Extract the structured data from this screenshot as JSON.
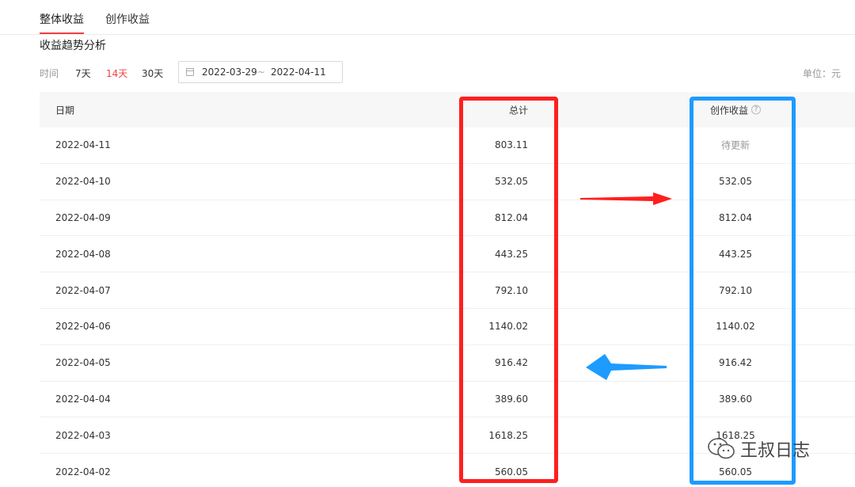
{
  "tabs": [
    {
      "label": "整体收益",
      "active": true
    },
    {
      "label": "创作收益",
      "active": false
    }
  ],
  "section_title": "收益趋势分析",
  "filters": {
    "time_label": "时间",
    "ranges": [
      {
        "label": "7天",
        "active": false
      },
      {
        "label": "14天",
        "active": true
      },
      {
        "label": "30天",
        "active": false
      }
    ],
    "start_date": "2022-03-29",
    "separator": "~",
    "end_date": "2022-04-11",
    "unit": "单位：元"
  },
  "table": {
    "headers": {
      "date": "日期",
      "total": "总计",
      "creation": "创作收益"
    },
    "rows": [
      {
        "date": "2022-04-11",
        "total": "803.11",
        "creation": "待更新"
      },
      {
        "date": "2022-04-10",
        "total": "532.05",
        "creation": "532.05"
      },
      {
        "date": "2022-04-09",
        "total": "812.04",
        "creation": "812.04"
      },
      {
        "date": "2022-04-08",
        "total": "443.25",
        "creation": "443.25"
      },
      {
        "date": "2022-04-07",
        "total": "792.10",
        "creation": "792.10"
      },
      {
        "date": "2022-04-06",
        "total": "1140.02",
        "creation": "1140.02"
      },
      {
        "date": "2022-04-05",
        "total": "916.42",
        "creation": "916.42"
      },
      {
        "date": "2022-04-04",
        "total": "389.60",
        "creation": "389.60"
      },
      {
        "date": "2022-04-03",
        "total": "1618.25",
        "creation": "1618.25"
      },
      {
        "date": "2022-04-02",
        "total": "560.05",
        "creation": "560.05"
      }
    ]
  },
  "annotations": {
    "red": "#ff1f1f",
    "blue": "#1d9bff"
  },
  "watermark": {
    "text": "王叔日志",
    "icon": "wechat-icon"
  }
}
